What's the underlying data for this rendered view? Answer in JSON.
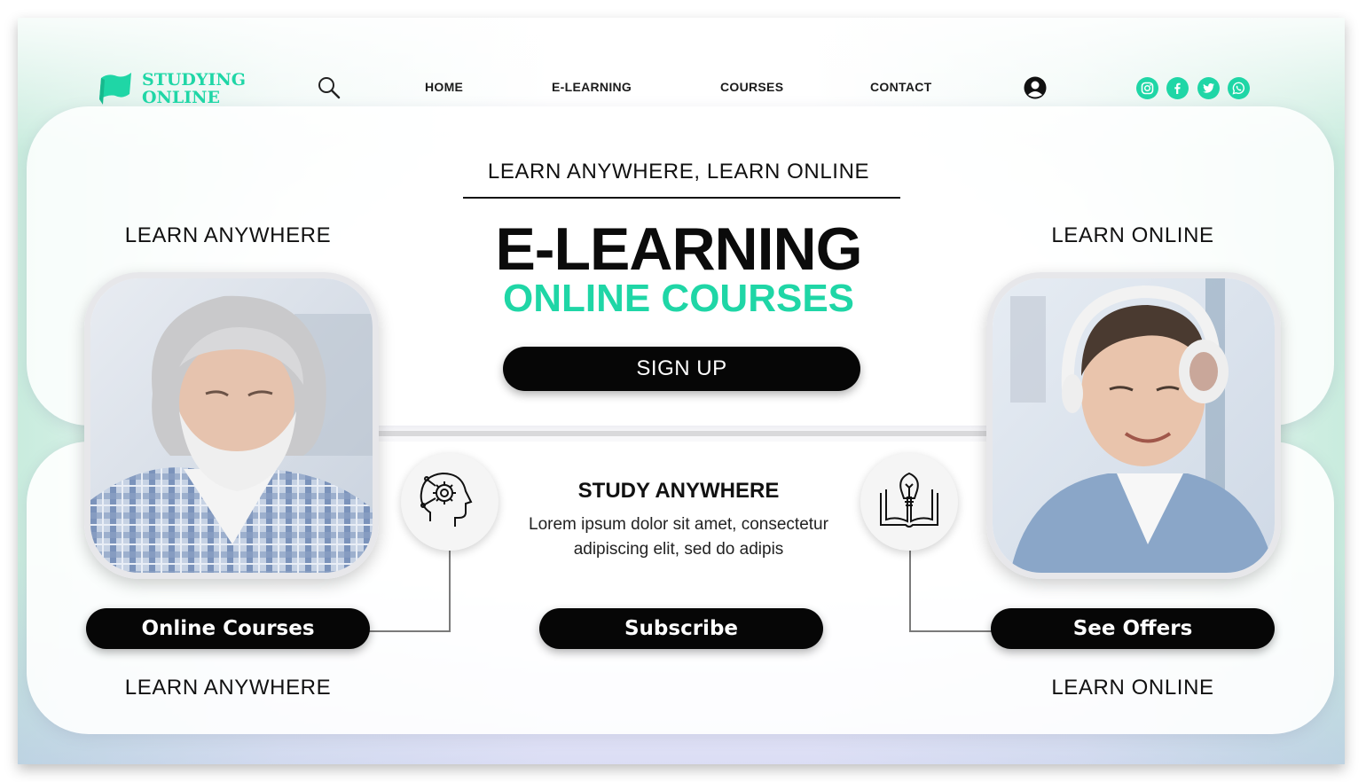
{
  "brand": {
    "line1": "STUDYING",
    "line2": "ONLINE",
    "accent": "#1fd6a6"
  },
  "nav": {
    "search_icon": "search-icon",
    "links": [
      {
        "label": "HOME"
      },
      {
        "label": "E-LEARNING"
      },
      {
        "label": "COURSES"
      },
      {
        "label": "CONTACT"
      }
    ],
    "account_icon": "user-circle-icon",
    "social": [
      "instagram-icon",
      "facebook-icon",
      "twitter-icon",
      "whatsapp-icon"
    ]
  },
  "hero": {
    "tagline": "LEARN ANYWHERE, LEARN ONLINE",
    "title": "E-LEARNING",
    "subtitle": "ONLINE COURSES",
    "cta": "SIGN UP"
  },
  "left": {
    "top_label": "LEARN ANYWHERE",
    "button": "Online Courses",
    "bottom_label": "LEARN ANYWHERE"
  },
  "right": {
    "top_label": "LEARN ONLINE",
    "button": "See Offers",
    "bottom_label": "LEARN ONLINE"
  },
  "center": {
    "title": "STUDY ANYWHERE",
    "body_line1": "Lorem ipsum dolor sit amet, consectetur",
    "body_line2": "adipiscing elit, sed do  adipis",
    "button": "Subscribe",
    "left_icon": "head-gear-icon",
    "right_icon": "book-lightbulb-icon"
  }
}
